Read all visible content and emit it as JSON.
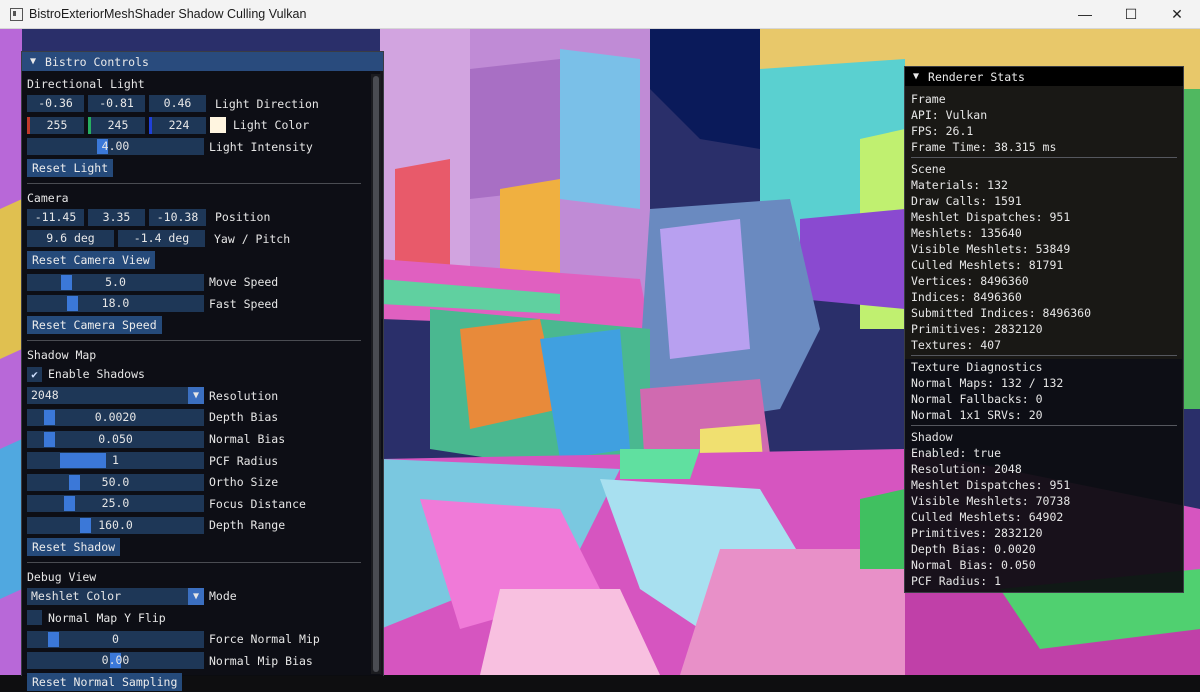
{
  "window": {
    "title": "BistroExteriorMeshShader Shadow Culling Vulkan",
    "minimize": "—",
    "maximize": "☐",
    "close": "✕"
  },
  "controls": {
    "title": "Bistro Controls",
    "directional_light": {
      "header": "Directional Light",
      "direction": [
        "-0.36",
        "-0.81",
        "0.46"
      ],
      "direction_label": "Light Direction",
      "color": [
        "255",
        "245",
        "224"
      ],
      "color_label": "Light Color",
      "swatch_color": "#fff5e0",
      "intensity": "4.00",
      "intensity_fraction": 0.42,
      "intensity_label": "Light Intensity",
      "reset": "Reset Light"
    },
    "camera": {
      "header": "Camera",
      "position": [
        "-11.45",
        "3.35",
        "-10.38"
      ],
      "position_label": "Position",
      "yaw_pitch": [
        "9.6 deg",
        "-1.4 deg"
      ],
      "yaw_pitch_label": "Yaw / Pitch",
      "reset_view": "Reset Camera View",
      "move_speed": "5.0",
      "move_speed_fraction": 0.2,
      "move_speed_label": "Move Speed",
      "fast_speed": "18.0",
      "fast_speed_fraction": 0.24,
      "fast_speed_label": "Fast Speed",
      "reset_speed": "Reset Camera Speed"
    },
    "shadow_map": {
      "header": "Shadow Map",
      "enable": "Enable Shadows",
      "enable_check": "✔",
      "resolution": "2048",
      "resolution_label": "Resolution",
      "depth_bias": "0.0020",
      "depth_bias_fraction": 0.1,
      "depth_bias_label": "Depth Bias",
      "normal_bias": "0.050",
      "normal_bias_fraction": 0.1,
      "normal_bias_label": "Normal Bias",
      "pcf_radius": "1",
      "pcf_radius_fraction": 0.25,
      "pcf_radius_label": "PCF Radius",
      "ortho_size": "50.0",
      "ortho_size_fraction": 0.25,
      "ortho_size_label": "Ortho Size",
      "focus_distance": "25.0",
      "focus_distance_fraction": 0.22,
      "focus_distance_label": "Focus Distance",
      "depth_range": "160.0",
      "depth_range_fraction": 0.32,
      "depth_range_label": "Depth Range",
      "reset": "Reset Shadow"
    },
    "debug_view": {
      "header": "Debug View",
      "mode": "Meshlet Color",
      "mode_label": "Mode",
      "flip": "Normal Map Y Flip",
      "force_mip": "0",
      "force_mip_fraction": 0.12,
      "force_mip_label": "Force Normal Mip",
      "mip_bias": "0.00",
      "mip_bias_fraction": 0.5,
      "mip_bias_label": "Normal Mip Bias",
      "reset": "Reset Normal Sampling"
    }
  },
  "stats": {
    "title": "Renderer Stats",
    "sections": [
      {
        "header": "Frame",
        "lines": [
          "API: Vulkan",
          "FPS: 26.1",
          "Frame Time: 38.315 ms"
        ]
      },
      {
        "header": "Scene",
        "lines": [
          "Materials: 132",
          "Draw Calls: 1591",
          "Meshlet Dispatches: 951",
          "Meshlets: 135640",
          "Visible Meshlets: 53849",
          "Culled Meshlets: 81791",
          "Vertices: 8496360",
          "Indices: 8496360",
          "Submitted Indices: 8496360",
          "Primitives: 2832120",
          "Textures: 407"
        ]
      },
      {
        "header": "Texture Diagnostics",
        "lines": [
          "Normal Maps: 132 / 132",
          "Normal Fallbacks: 0",
          "Normal 1x1 SRVs: 20"
        ]
      },
      {
        "header": "Shadow",
        "lines": [
          "Enabled: true",
          "Resolution: 2048",
          "Meshlet Dispatches: 951",
          "Visible Meshlets: 70738",
          "Culled Meshlets: 64902",
          "Primitives: 2832120",
          "Depth Bias: 0.0020",
          "Normal Bias: 0.050",
          "PCF Radius: 1"
        ]
      }
    ]
  }
}
